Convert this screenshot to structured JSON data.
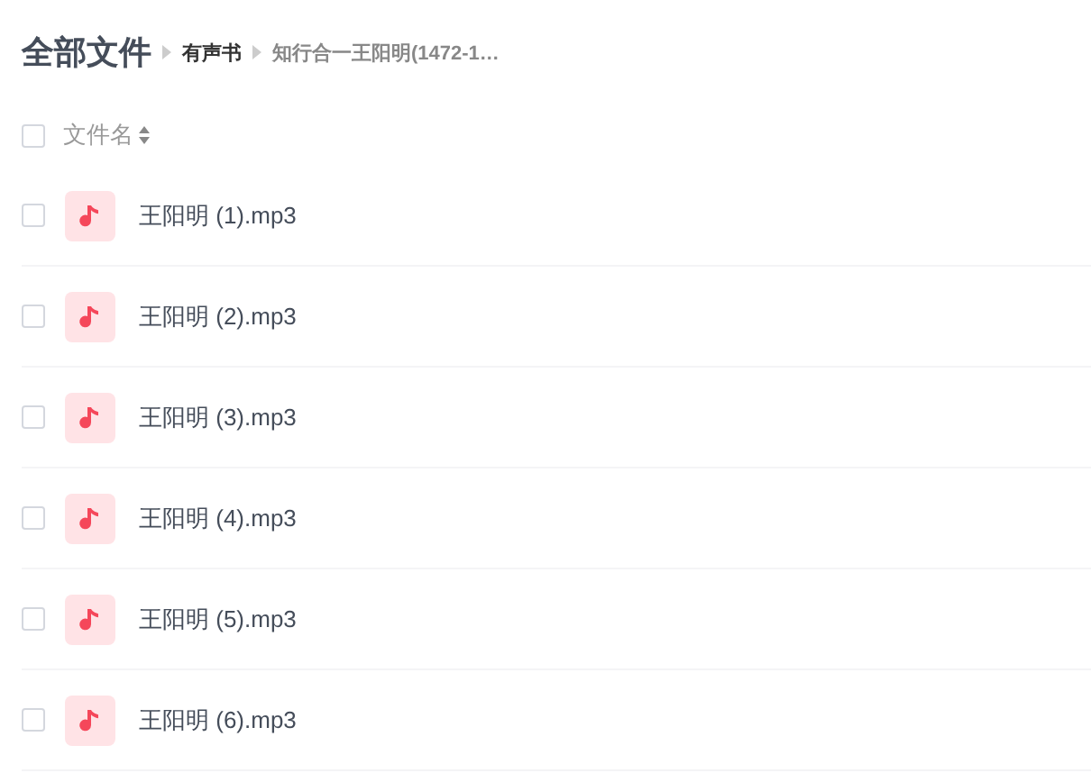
{
  "breadcrumb": [
    {
      "label": "全部文件",
      "kind": "root"
    },
    {
      "label": "有声书",
      "kind": "folder"
    },
    {
      "label": "知行合一王阳明(1472-1…",
      "kind": "current"
    }
  ],
  "header": {
    "checked": false,
    "column": "文件名"
  },
  "files": [
    {
      "name": "王阳明 (1).mp3",
      "checked": false
    },
    {
      "name": "王阳明 (2).mp3",
      "checked": false
    },
    {
      "name": "王阳明 (3).mp3",
      "checked": false
    },
    {
      "name": "王阳明 (4).mp3",
      "checked": false
    },
    {
      "name": "王阳明 (5).mp3",
      "checked": false
    },
    {
      "name": "王阳明 (6).mp3",
      "checked": false
    }
  ]
}
